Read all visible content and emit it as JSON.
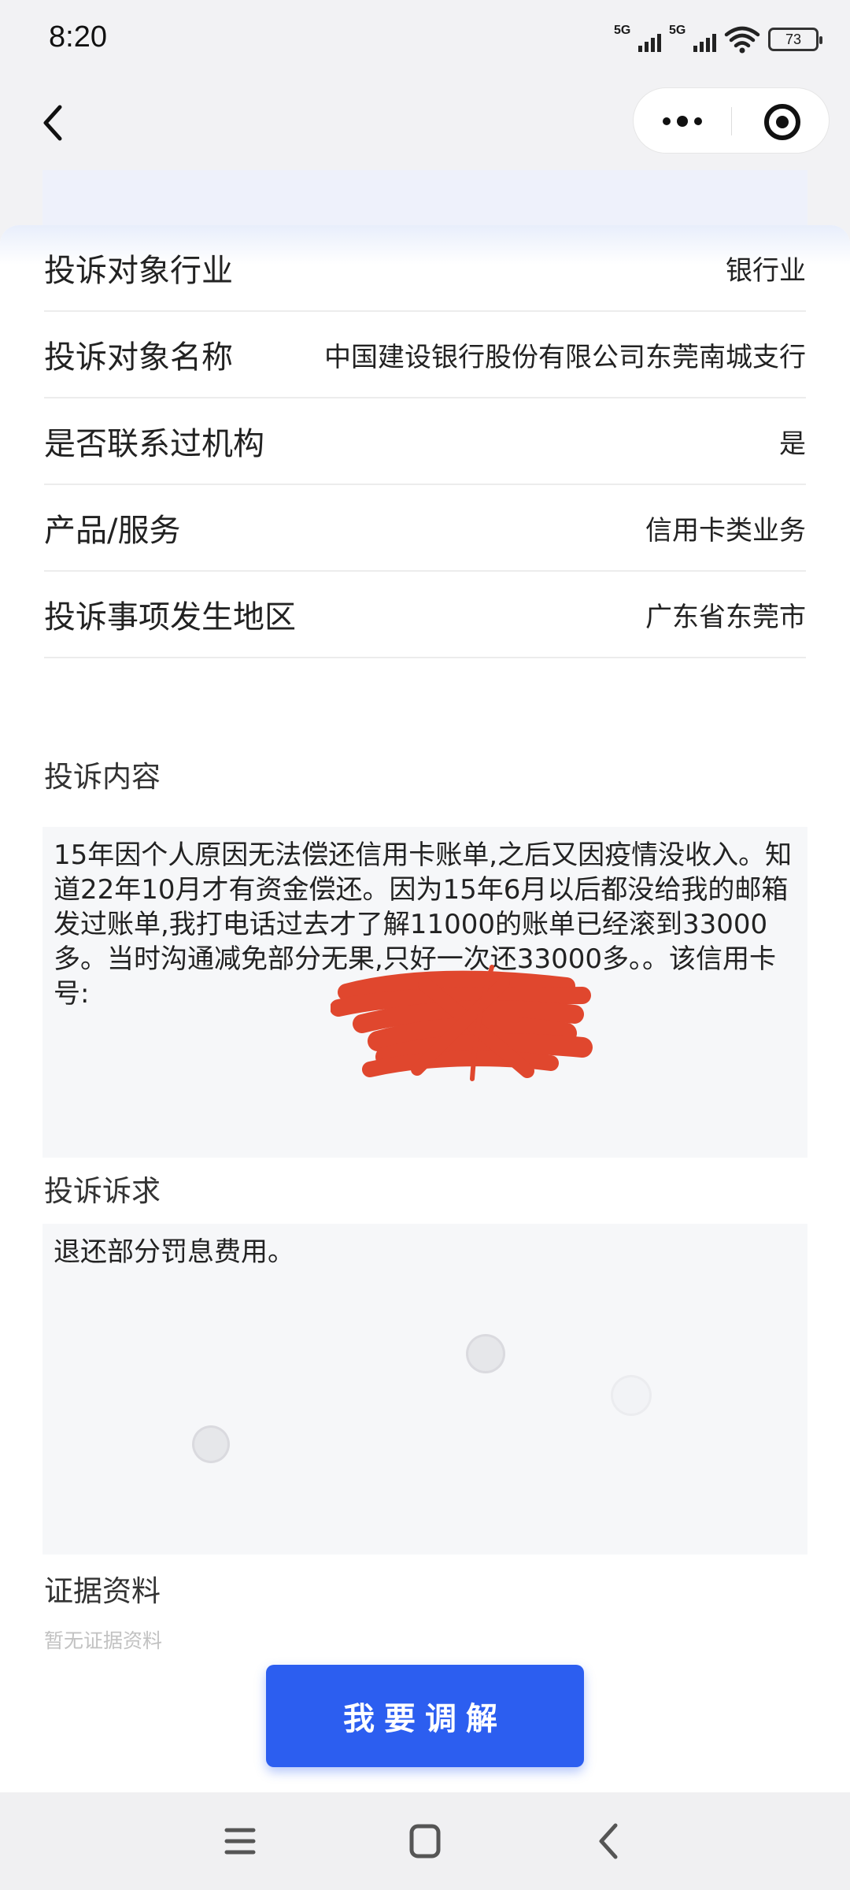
{
  "status_bar": {
    "time": "8:20",
    "signal1_label": "5G",
    "signal2_label": "5G",
    "battery": "73",
    "icons": [
      "signal-5g-icon",
      "signal-5g-icon",
      "wifi-6-icon",
      "battery-icon"
    ]
  },
  "nav": {
    "back_icon": "chevron-left-icon",
    "more_icon": "more-dots-icon",
    "close_icon": "target-circle-icon"
  },
  "info_rows": [
    {
      "label": "投诉对象行业",
      "value": "银行业"
    },
    {
      "label": "投诉对象名称",
      "value": "中国建设银行股份有限公司东莞南城支行"
    },
    {
      "label": "是否联系过机构",
      "value": "是"
    },
    {
      "label": "产品/服务",
      "value": "信用卡类业务"
    },
    {
      "label": "投诉事项发生地区",
      "value": "广东省东莞市"
    }
  ],
  "complaint": {
    "label": "投诉内容",
    "text": "15年因个人原因无法偿还信用卡账单,之后又因疫情没收入。知道22年10月才有资金偿还。因为15年6月以后都没给我的邮箱发过账单,我打电话过去才了解11000的账单已经滚到33000多。当时沟通减免部分无果,只好一次还33000多。。该信用卡号:"
  },
  "appeal": {
    "label": "投诉诉求",
    "text": "退还部分罚息费用。"
  },
  "evidence": {
    "label": "证据资料",
    "empty_text": "暂无证据资料"
  },
  "cta": {
    "label": "我要调解"
  },
  "system_nav": {
    "icons": [
      "menu-lines-icon",
      "home-square-icon",
      "back-chevron-icon"
    ]
  },
  "colors": {
    "primary": "#2C5EF0",
    "scribble": "#E0472E",
    "box_bg": "#F6F7F9"
  }
}
